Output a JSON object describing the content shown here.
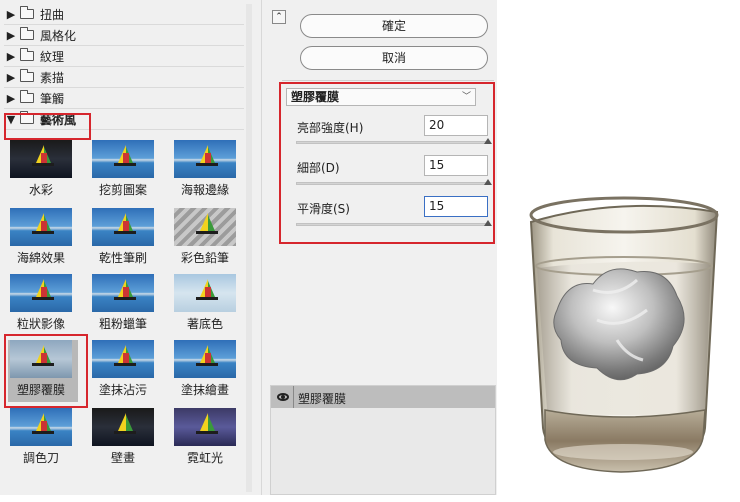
{
  "gallery": {
    "categories": [
      {
        "label": "扭曲",
        "open": false
      },
      {
        "label": "風格化",
        "open": false
      },
      {
        "label": "紋理",
        "open": false
      },
      {
        "label": "素描",
        "open": false
      },
      {
        "label": "筆觸",
        "open": false
      },
      {
        "label": "藝術風",
        "open": true
      }
    ],
    "filters": [
      {
        "label": "水彩"
      },
      {
        "label": "挖剪圖案"
      },
      {
        "label": "海報邊緣"
      },
      {
        "label": "海綿效果"
      },
      {
        "label": "乾性筆刷"
      },
      {
        "label": "彩色鉛筆"
      },
      {
        "label": "粒狀影像"
      },
      {
        "label": "粗粉蠟筆"
      },
      {
        "label": "著底色"
      },
      {
        "label": "塑膠覆膜"
      },
      {
        "label": "塗抹沾污"
      },
      {
        "label": "塗抹繪畫"
      },
      {
        "label": "調色刀"
      },
      {
        "label": "壁畫"
      },
      {
        "label": "霓虹光"
      }
    ],
    "selected_filter": "塑膠覆膜"
  },
  "settings": {
    "ok_label": "確定",
    "cancel_label": "取消",
    "filter_dropdown": "塑膠覆膜",
    "params": [
      {
        "label": "亮部強度(H)",
        "value": "20",
        "fraction": 1.0
      },
      {
        "label": "細部(D)",
        "value": "15",
        "fraction": 1.0
      },
      {
        "label": "平滑度(S)",
        "value": "15",
        "fraction": 1.0
      }
    ]
  },
  "layers": {
    "active_layer": "塑膠覆膜"
  },
  "colors": {
    "highlight": "#d6262d",
    "panel": "#f0f0f0",
    "selected_row": "#bdbdbd"
  }
}
